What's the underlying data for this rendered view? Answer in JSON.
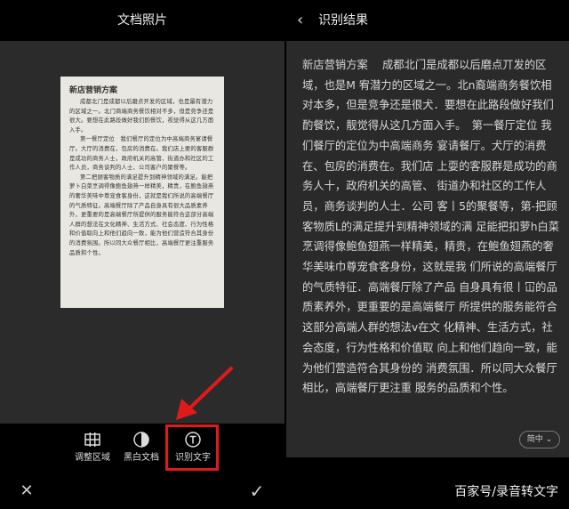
{
  "left_panel": {
    "title": "文档照片",
    "document": {
      "title": "新店营销方案",
      "paragraphs": [
        "成都北门是成都以后磨点开发的区域，也是最有潜力的区域之一。北门商端商务餐饮相对不多，但是竞争还是很大。要想在此路段做好我们酌餐饮，视觉得从这几方面入手。",
        "第一餐厅定位　我们餐厅的定位为中高端商务宴请餐厅。大厅的消费在，包房的消费在。我们店上要的客服群是成功的商务人士，政府机关的高管、街道办和社区的工作人员，商务谈判的人士、公司客户的聚餐等。",
        "第二把顾客物质的满足提升到精神领域的满足。能把萝卜白菜烹调得像鲍鱼翅燕一样精美，精贵，在鲍鱼翅燕的奢华美味中尊宠食客身份，这就是我们所说的高端餐厅的气质特征。高端餐厅除了产品自身具有很大品质素养外，更重要的是高端餐厅所提供的服务能符合这部分高端人群的想法在文化精神、生活方式、社会态度、行为性格和价值取向上和他们趋向一致，能为他们营造符合其身份的消费氛围。所以同大众餐厅相比，高端餐厅更注重服务品质和个性。"
      ]
    },
    "toolbar": {
      "adjust_label": "调整区域",
      "bw_label": "黑白文档",
      "ocr_label": "识别文字"
    },
    "highlight_color": "#e01a1a"
  },
  "right_panel": {
    "title": "识别结果",
    "result_text": "新店营销方案　 成都北门是成都以后磨点丌发的区域，也是M 宥潜力的区域之一。北n裔端商务餐饮相对本多，但是竞争还是很犬．要想在此路段做好我们酌餐饮，靓觉得从这几方面入手。　第一餐厅定位 我们餐厅的定位为中高端商务 宴请餐厅。犬厅的消费在、包房的消费在。我们店 上耍的客服群是成功的商务人十，政府机关的高管、 街道办和社区的工作人员，商务谈判的人士．公司 客丨5的聚餐等，第-把顾客物质L的满足提升到精神领域的满 足能把扣萝h白菜烹调得像鲍鱼翅燕一样精美，精贵，在鲍鱼翅燕的奢华美味巾尊宠食客身份，这就是我 们所说的高端餐厅的气质特征．高端餐厅除了产品 自身具有很丨冚的品质素养外，更重要的是高端餐厅 所提供的服务能符合这部分高端人群的想法v在文 化精神、生活方式，社会态度，行为性格和价值取 向上和他们趋向一致，能为他们营造符合其身份的 消费氛围．所以同大众餐厅相比，高端餐厅更注重 服务的品质和个性。",
    "language_button": "简中 ⌄",
    "watermark": "百家号/录音转文字"
  }
}
